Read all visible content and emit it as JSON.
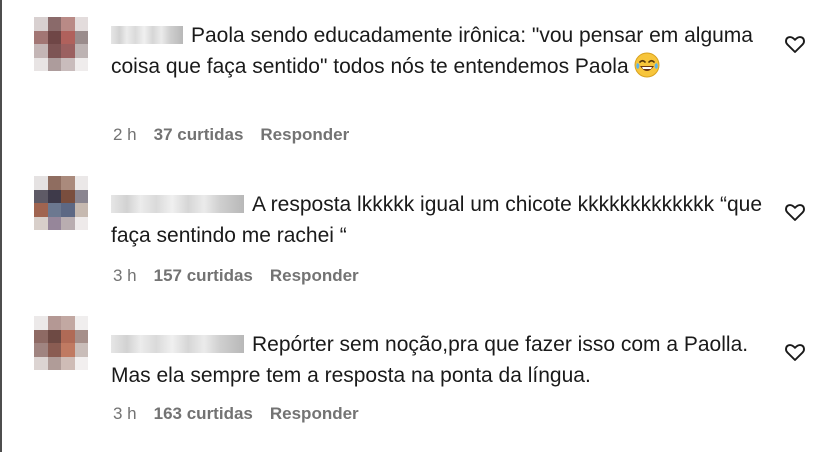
{
  "comments": [
    {
      "username": "usuário",
      "text": "Paola sendo educadamente irônica: \"vou pensar em alguma coisa que faça sentido\" todos nós te entendemos Paola",
      "emoji": "😂",
      "time": "2 h",
      "likes": "37 curtidas",
      "reply_label": "Responder"
    },
    {
      "username": "usuário",
      "text": "A resposta lkkkkk igual um chicote kkkkkkkkkkkkk “que faça sentindo me rachei “",
      "time": "3 h",
      "likes": "157 curtidas",
      "reply_label": "Responder"
    },
    {
      "username": "usuário",
      "text": "Repórter sem noção,pra que fazer isso com a Paolla. Mas ela sempre tem a resposta na ponta da língua.",
      "time": "3 h",
      "likes": "163 curtidas",
      "reply_label": "Responder"
    }
  ],
  "icons": {
    "like": "heart-outline-icon",
    "emoji": "tears-of-joy-emoji"
  },
  "colors": {
    "text": "#1a1a1a",
    "meta": "#737373",
    "background": "#ffffff"
  }
}
